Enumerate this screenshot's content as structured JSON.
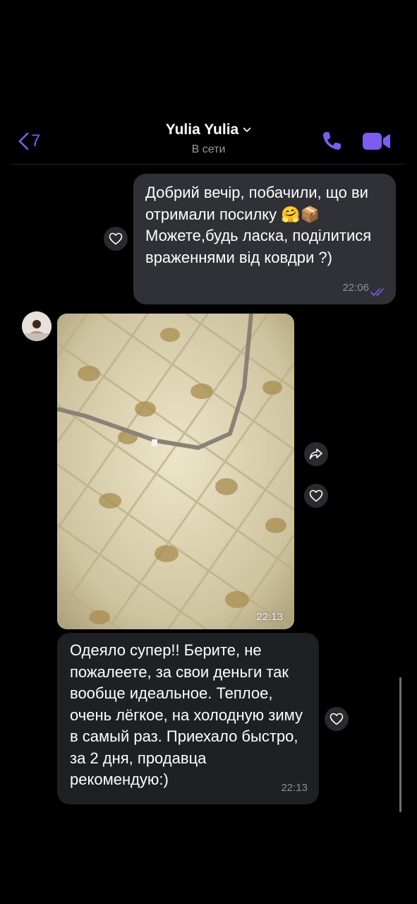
{
  "header": {
    "back_count": "7",
    "contact_name": "Yulia Yulia",
    "status": "В сети",
    "icons": {
      "back": "chevron-left-icon",
      "call": "phone-icon",
      "video": "video-camera-icon",
      "dropdown": "chevron-down-icon"
    },
    "accent_color": "#7d5cf0"
  },
  "messages": [
    {
      "direction": "outgoing",
      "text": "Добрий вечір, побачили, що ви отримали посилку 🤗📦 Можете,будь ласка, поділитися враженнями від ковдри ?)",
      "time": "22:06",
      "status_icon": "double-check-icon"
    },
    {
      "direction": "incoming",
      "type": "photo",
      "description_icon": "blanket-photo",
      "time": "22:13"
    },
    {
      "direction": "incoming",
      "text": "Одеяло супер!! Берите, не пожалеете, за свои деньги так вообще идеальное. Теплое, очень лёгкое, на холодную зиму в самый раз. Приехало быстро, за 2 дня, продавца рекомендую:)",
      "time": "22:13"
    }
  ]
}
